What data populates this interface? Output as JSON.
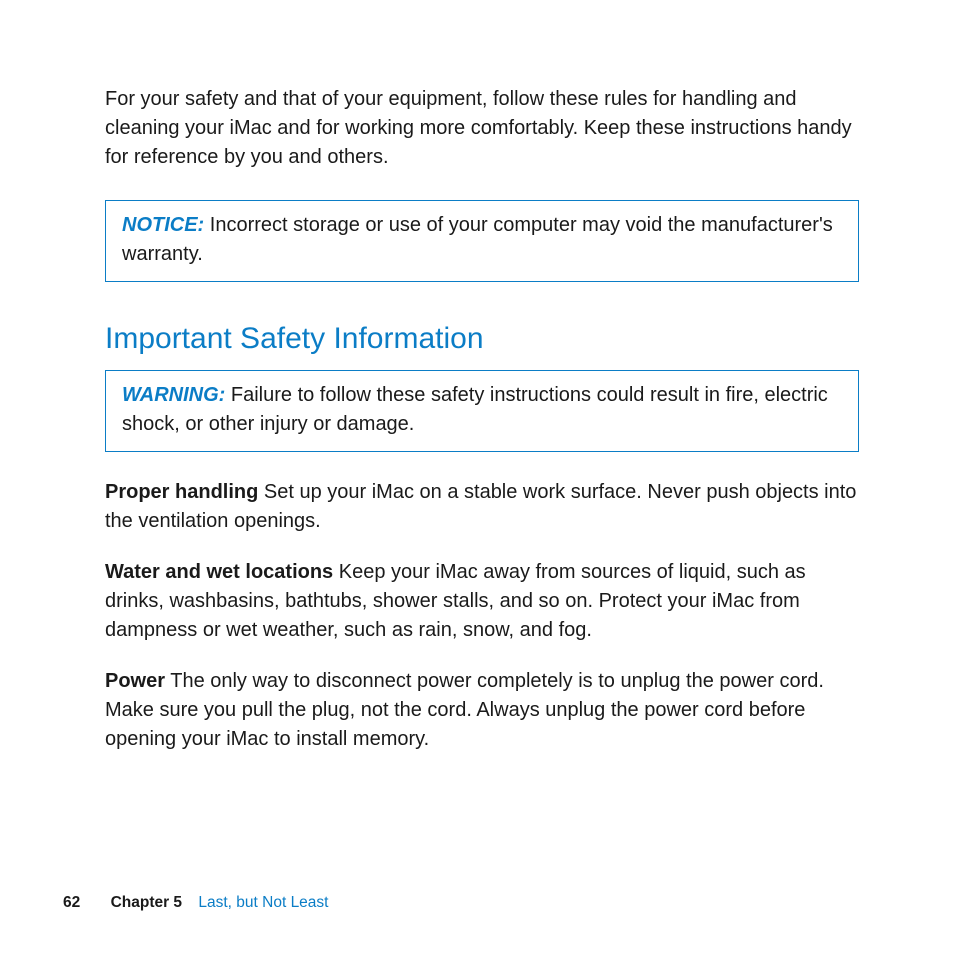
{
  "intro": "For your safety and that of your equipment, follow these rules for handling and cleaning your iMac and for working more comfortably. Keep these instructions handy for reference by you and others.",
  "notice": {
    "label": "NOTICE:",
    "text": "  Incorrect storage or use of your computer may void the manufacturer's warranty."
  },
  "section_heading": "Important Safety Information",
  "warning": {
    "label": "WARNING:",
    "text": "  Failure to follow these safety instructions could result in fire, electric shock, or other injury or damage."
  },
  "paragraphs": [
    {
      "run_in": "Proper handling",
      "text": "   Set up your iMac on a stable work surface. Never push objects into the ventilation openings."
    },
    {
      "run_in": "Water and wet locations",
      "text": "   Keep your iMac away from sources of liquid, such as drinks, washbasins, bathtubs, shower stalls, and so on. Protect your iMac from dampness or wet weather, such as rain, snow, and fog."
    },
    {
      "run_in": "Power",
      "text": "   The only way to disconnect power completely is to unplug the power cord. Make sure you pull the plug, not the cord. Always unplug the power cord before opening your iMac to install memory."
    }
  ],
  "footer": {
    "page_number": "62",
    "chapter_label": "Chapter 5",
    "chapter_title": "Last, but Not Least"
  },
  "colors": {
    "accent": "#0b7dc6",
    "text": "#1a1a1a"
  }
}
